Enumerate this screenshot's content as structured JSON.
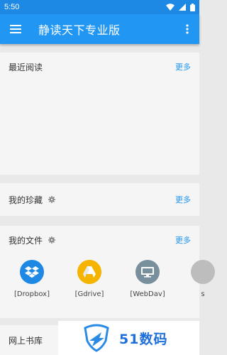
{
  "status_bar": {
    "time": "5:50",
    "icons": [
      "wifi-icon",
      "signal-icon",
      "battery-icon"
    ]
  },
  "app_bar": {
    "title": "静读天下专业版",
    "menu_icon": "hamburger-menu-icon",
    "overflow_icon": "vertical-dots-icon"
  },
  "sections": {
    "recent": {
      "title": "最近阅读",
      "more": "更多"
    },
    "favorites": {
      "title": "我的珍藏",
      "more": "更多"
    },
    "files": {
      "title": "我的文件",
      "more": "更多"
    },
    "library": {
      "title": "网上书库"
    }
  },
  "storage_items": [
    {
      "label": "[Dropbox]",
      "icon": "dropbox-icon",
      "color": "#1e88e5"
    },
    {
      "label": "[Gdrive]",
      "icon": "google-drive-icon",
      "color": "#f4b400"
    },
    {
      "label": "[WebDav]",
      "icon": "monitor-icon",
      "color": "#78909c"
    },
    {
      "label": "s",
      "icon": "storage-icon",
      "color": "#bdbdbd"
    }
  ],
  "watermark": {
    "text": "51数码"
  },
  "colors": {
    "app_bar": "#2196f3",
    "status_bar": "#1e88e5",
    "link": "#2196f3",
    "background": "#e9e9e9"
  }
}
